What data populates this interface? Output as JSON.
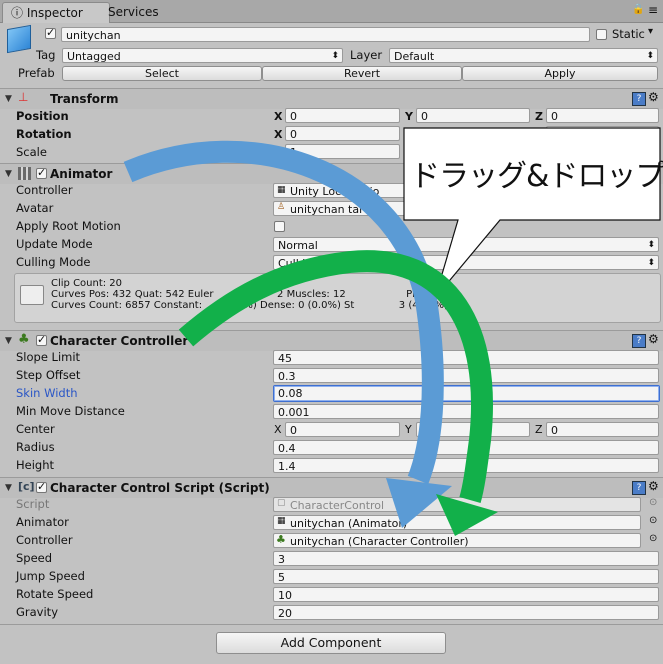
{
  "tabs": {
    "inspector": "Inspector",
    "services": "Services"
  },
  "object": {
    "name": "unitychan",
    "static_label": "Static",
    "tag_label": "Tag",
    "tag_value": "Untagged",
    "layer_label": "Layer",
    "layer_value": "Default",
    "prefab_label": "Prefab",
    "select": "Select",
    "revert": "Revert",
    "apply": "Apply"
  },
  "transform": {
    "title": "Transform",
    "position": "Position",
    "rotation": "Rotation",
    "scale": "Scale",
    "x": "X",
    "y": "Y",
    "z": "Z",
    "pos_x": "0",
    "pos_y": "0",
    "pos_z": "0",
    "rot_x": "0",
    "scale_x": "1"
  },
  "animator": {
    "title": "Animator",
    "controller": "Controller",
    "controller_value": "Unity     Locomotio",
    "avatar": "Avatar",
    "avatar_value": "unitychan     tar",
    "apply_root_motion": "Apply Root Motion",
    "update_mode": "Update Mode",
    "update_mode_value": "Normal",
    "culling_mode": "Culling Mode",
    "culling_mode_value": "Cull Update Transform",
    "info1": "Clip Count: 20",
    "info2": "Curves Pos: 432 Quat: 542 Euler                    2 Muscles: 12                   PPtr: 0",
    "info3": "Curves Count: 6857 Constant:        4.0%) Dense: 0 (0.0%) St              3 (46.0%)"
  },
  "charcontroller": {
    "title": "Character Controller",
    "slope_limit": "Slope Limit",
    "slope_limit_value": "45",
    "step_offset": "Step Offset",
    "step_offset_value": "0.3",
    "skin_width": "Skin Width",
    "skin_width_value": "0.08",
    "min_move": "Min Move Distance",
    "min_move_value": "0.001",
    "center": "Center",
    "center_x": "0",
    "center_z": "0",
    "radius": "Radius",
    "radius_value": "0.4",
    "height": "Height",
    "height_value": "1.4"
  },
  "script": {
    "title": "Character Control Script (Script)",
    "script": "Script",
    "script_value": "CharacterControl",
    "animator": "Animator",
    "animator_value": "unitychan (Animator)",
    "controller": "Controller",
    "controller_value": "unitychan (Character Controller)",
    "speed": "Speed",
    "speed_value": "3",
    "jump_speed": "Jump Speed",
    "jump_speed_value": "5",
    "rotate_speed": "Rotate Speed",
    "rotate_speed_value": "10",
    "gravity": "Gravity",
    "gravity_value": "20"
  },
  "add_component": "Add Component",
  "callout": "ドラッグ&ドロップ",
  "colors": {
    "blue_arrow": "#5b9bd5",
    "green_arrow": "#12b04a",
    "selection": "#3e6fd1",
    "label_selected": "#2a56c6"
  }
}
